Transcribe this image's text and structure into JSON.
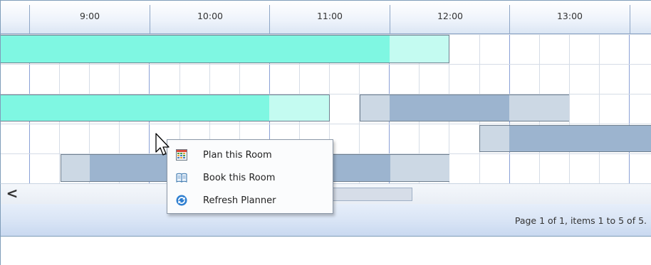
{
  "header": {
    "hours": [
      "9:00",
      "10:00",
      "11:00",
      "12:00",
      "13:00"
    ]
  },
  "scrollbar": {
    "left_arrow": "<"
  },
  "footer": {
    "pager_text": "Page 1 of 1, items 1 to 5 of 5."
  },
  "context_menu": {
    "items": [
      {
        "label": "Plan this Room",
        "icon": "calendar-grid-icon"
      },
      {
        "label": "Book this Room",
        "icon": "open-book-icon"
      },
      {
        "label": "Refresh Planner",
        "icon": "refresh-icon"
      }
    ]
  },
  "colors": {
    "booking_bright": "#7ff7e2",
    "booking_pale": "#c4fbf1",
    "blocked_dark": "#9cb4cf",
    "blocked_light": "#ccd8e4",
    "hour_line": "#8aa0d6"
  }
}
